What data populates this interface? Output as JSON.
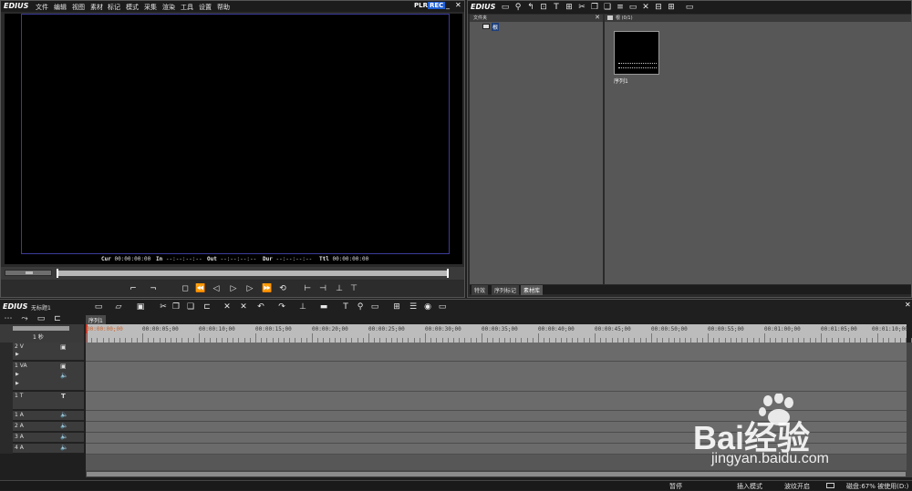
{
  "player": {
    "logo": "EDIUS",
    "menu": [
      "文件",
      "编辑",
      "视图",
      "素材",
      "标记",
      "模式",
      "采集",
      "渲染",
      "工具",
      "设置",
      "帮助"
    ],
    "plr_label": "PLR",
    "rec_label": "REC",
    "timecodes": {
      "cur_label": "Cur",
      "cur_value": "00:00:00:00",
      "in_label": "In",
      "in_value": "--:--:--:--",
      "out_label": "Out",
      "out_value": "--:--:--:--",
      "dur_label": "Dur",
      "dur_value": "--:--:--:--",
      "ttl_label": "Ttl",
      "ttl_value": "00:00:00:00"
    }
  },
  "bin": {
    "logo": "EDIUS",
    "folder_header": "文件夹",
    "folder_root": "根",
    "clip_area_header": "根 (0/1)",
    "clip_name": "序列1",
    "tabs": [
      "特效",
      "序列标记",
      "素材库"
    ]
  },
  "timeline": {
    "logo": "EDIUS",
    "project_name": "无标题1",
    "sequence_tab": "序列1",
    "scale_label": "1 秒",
    "ruler": [
      "00:00:00;00",
      "00:00:05;00",
      "00:00:10;00",
      "00:00:15;00",
      "00:00:20;00",
      "00:00:25;00",
      "00:00:30;00",
      "00:00:35;00",
      "00:00:40;00",
      "00:00:45;00",
      "00:00:50;00",
      "00:00:55;00",
      "00:01:00;00",
      "00:01:05;00",
      "00:01:10;00"
    ],
    "tracks": [
      {
        "name": "2 V",
        "type": "video"
      },
      {
        "name": "1 VA",
        "type": "video-audio"
      },
      {
        "name": "1 T",
        "type": "title"
      },
      {
        "name": "1 A",
        "type": "audio"
      },
      {
        "name": "2 A",
        "type": "audio"
      },
      {
        "name": "3 A",
        "type": "audio"
      },
      {
        "name": "4 A",
        "type": "audio"
      }
    ]
  },
  "status": {
    "state": "暂停",
    "mode": "插入模式",
    "ripple": "波纹开启",
    "disk": "磁盘:67% 被使用(D:)"
  },
  "watermark": {
    "brand": "Bai经验",
    "url": "jingyan.baidu.com"
  },
  "colors": {
    "panel": "#575757",
    "lane": "#6b6b6b",
    "rec": "#1e5fd4",
    "safe_frame": "#3b3b9a",
    "ruler": "#bcbcbc"
  }
}
